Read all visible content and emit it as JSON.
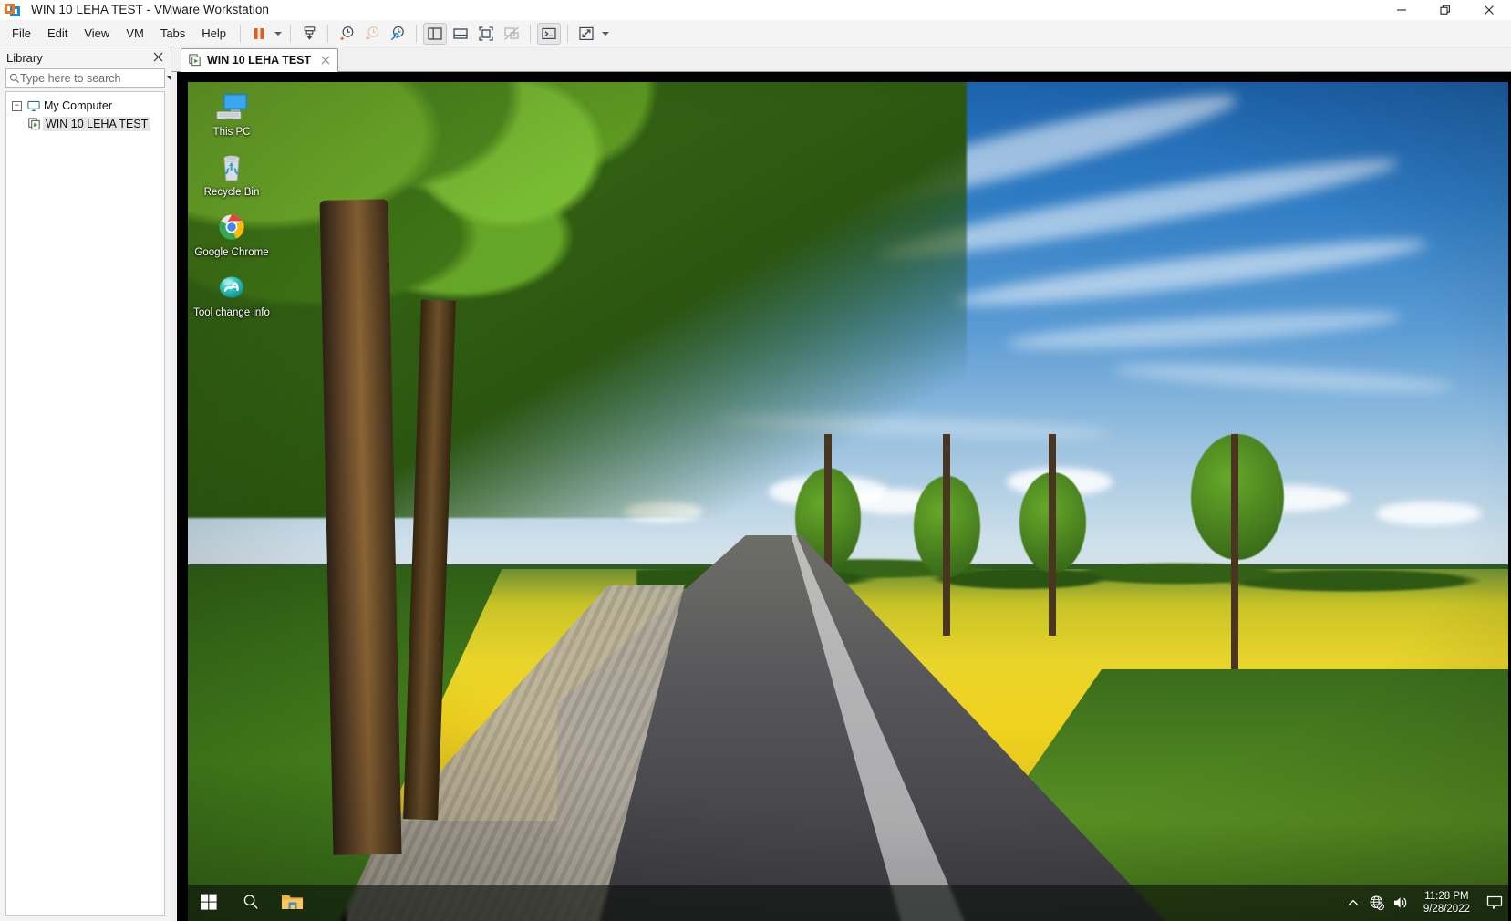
{
  "window": {
    "title": "WIN 10 LEHA TEST - VMware Workstation",
    "logo_icon": "vmware-logo-icon",
    "controls": {
      "minimize": "minimize-icon",
      "restore": "restore-icon",
      "close": "close-icon"
    }
  },
  "menubar": {
    "items": [
      {
        "label": "File"
      },
      {
        "label": "Edit"
      },
      {
        "label": "View"
      },
      {
        "label": "VM"
      },
      {
        "label": "Tabs"
      },
      {
        "label": "Help"
      }
    ]
  },
  "toolbar": {
    "buttons": [
      {
        "name": "suspend-vm-button",
        "icon": "pause-icon",
        "state": "normal"
      },
      {
        "name": "power-dropdown-button",
        "icon": "chevron-down-icon",
        "state": "normal"
      },
      {
        "name": "snapshot-save-button",
        "icon": "snapshot-save-icon",
        "state": "normal"
      },
      {
        "name": "take-snapshot-button",
        "icon": "clock-plus-icon",
        "state": "normal"
      },
      {
        "name": "revert-snapshot-button",
        "icon": "clock-revert-icon",
        "state": "disabled"
      },
      {
        "name": "snapshot-manager-button",
        "icon": "clock-wrench-icon",
        "state": "normal"
      },
      {
        "name": "show-library-button",
        "icon": "library-panel-icon",
        "state": "pressed"
      },
      {
        "name": "show-thumbnails-button",
        "icon": "thumbnail-bar-icon",
        "state": "normal"
      },
      {
        "name": "enter-fullscreen-button",
        "icon": "fullscreen-icon",
        "state": "normal"
      },
      {
        "name": "unity-mode-button",
        "icon": "unity-mode-icon",
        "state": "disabled"
      },
      {
        "name": "console-view-button",
        "icon": "terminal-icon",
        "state": "pressed"
      },
      {
        "name": "stretch-guest-button",
        "icon": "expand-arrows-icon",
        "state": "normal"
      },
      {
        "name": "stretch-dropdown-button",
        "icon": "chevron-down-icon",
        "state": "normal"
      }
    ]
  },
  "sidebar": {
    "title": "Library",
    "close_icon": "close-icon",
    "search": {
      "placeholder": "Type here to search",
      "value": "",
      "icon": "search-icon",
      "dropdown_icon": "chevron-down-icon"
    },
    "tree": {
      "root": {
        "label": "My Computer",
        "icon": "monitor-icon",
        "expander": "−",
        "expanded": true
      },
      "children": [
        {
          "label": "WIN 10 LEHA TEST",
          "icon": "vm-running-icon",
          "selected": true
        }
      ]
    }
  },
  "tab": {
    "label": "WIN 10 LEHA TEST",
    "icon": "vm-running-icon",
    "close_icon": "close-icon",
    "active": true
  },
  "guest": {
    "os": "Windows 10",
    "desktop_icons": [
      {
        "name": "this-pc",
        "label": "This PC",
        "icon": "monitor-computer-icon"
      },
      {
        "name": "recycle-bin",
        "label": "Recycle Bin",
        "icon": "recycle-bin-icon"
      },
      {
        "name": "google-chrome",
        "label": "Google Chrome",
        "icon": "chrome-icon"
      },
      {
        "name": "tool-change-info",
        "label": "Tool change info",
        "icon": "tool-change-icon"
      }
    ],
    "taskbar": {
      "start": {
        "name": "start-button",
        "icon": "windows-logo-icon"
      },
      "search": {
        "name": "taskbar-search-button",
        "icon": "search-icon"
      },
      "file_explorer": {
        "name": "file-explorer-button",
        "icon": "folder-icon"
      },
      "tray": [
        {
          "name": "show-hidden-icons-button",
          "icon": "chevron-up-icon"
        },
        {
          "name": "network-status-icon",
          "icon": "globe-no-internet-icon"
        },
        {
          "name": "volume-icon",
          "icon": "speaker-icon"
        }
      ],
      "clock": {
        "time": "11:28 PM",
        "date": "9/28/2022"
      },
      "action_center": {
        "name": "action-center-button",
        "icon": "speech-bubble-icon"
      }
    }
  },
  "colors": {
    "accent_orange": "#ef7622",
    "accent_blue": "#1a8dd8",
    "titlebar_bg": "#ffffff",
    "toolbar_bg": "#f4f4f4",
    "sidebar_bg": "#f4f4f4",
    "selection": "#e6e6e6"
  }
}
